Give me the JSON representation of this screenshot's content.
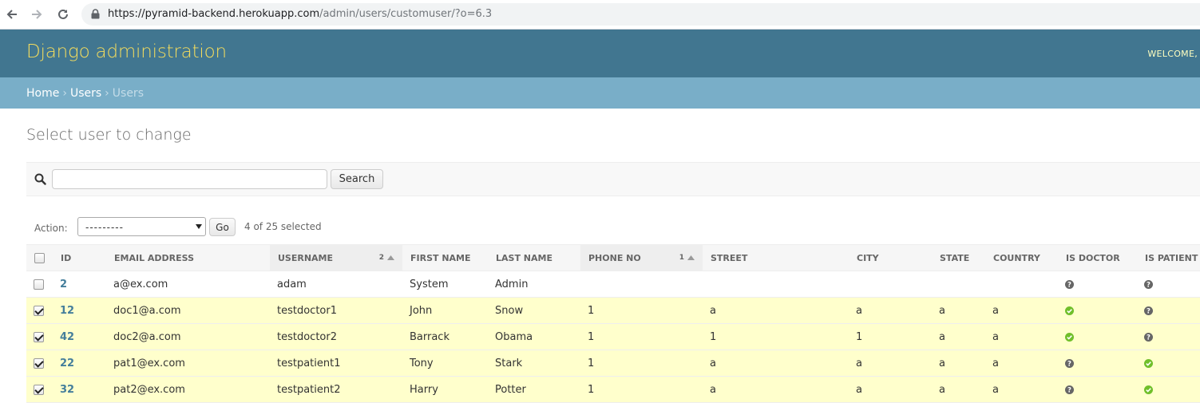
{
  "browser": {
    "url_host": "https://pyramid-backend.herokuapp.com",
    "url_path": "/admin/users/customuser/?o=6.3"
  },
  "header": {
    "branding": "Django administration",
    "user_tools": "WELCOME,"
  },
  "breadcrumbs": {
    "home": "Home",
    "app": "Users",
    "current": "Users",
    "separator": "›"
  },
  "page": {
    "title": "Select user to change"
  },
  "search": {
    "value": "",
    "placeholder": "",
    "button_label": "Search"
  },
  "actions": {
    "label": "Action:",
    "selected_value": "---------",
    "go_label": "Go",
    "counter": "4 of 25 selected"
  },
  "table": {
    "columns": [
      {
        "label": "ID"
      },
      {
        "label": "EMAIL ADDRESS"
      },
      {
        "label": "USERNAME",
        "sort_priority": "2",
        "sort_dir": "asc"
      },
      {
        "label": "FIRST NAME"
      },
      {
        "label": "LAST NAME"
      },
      {
        "label": "PHONE NO",
        "sort_priority": "1",
        "sort_dir": "asc"
      },
      {
        "label": "STREET"
      },
      {
        "label": "CITY"
      },
      {
        "label": "STATE"
      },
      {
        "label": "COUNTRY"
      },
      {
        "label": "IS DOCTOR"
      },
      {
        "label": "IS PATIENT"
      }
    ],
    "rows": [
      {
        "checked": false,
        "id": "2",
        "email": "a@ex.com",
        "username": "adam",
        "first_name": "System",
        "last_name": "Admin",
        "phone": "",
        "street": "",
        "city": "",
        "state": "",
        "country": "",
        "is_doctor": false,
        "is_patient": false
      },
      {
        "checked": true,
        "id": "12",
        "email": "doc1@a.com",
        "username": "testdoctor1",
        "first_name": "John",
        "last_name": "Snow",
        "phone": "1",
        "street": "a",
        "city": "a",
        "state": "a",
        "country": "a",
        "is_doctor": true,
        "is_patient": false
      },
      {
        "checked": true,
        "id": "42",
        "email": "doc2@a.com",
        "username": "testdoctor2",
        "first_name": "Barrack",
        "last_name": "Obama",
        "phone": "1",
        "street": "1",
        "city": "1",
        "state": "a",
        "country": "a",
        "is_doctor": true,
        "is_patient": false
      },
      {
        "checked": true,
        "id": "22",
        "email": "pat1@ex.com",
        "username": "testpatient1",
        "first_name": "Tony",
        "last_name": "Stark",
        "phone": "1",
        "street": "a",
        "city": "a",
        "state": "a",
        "country": "a",
        "is_doctor": false,
        "is_patient": true
      },
      {
        "checked": true,
        "id": "32",
        "email": "pat2@ex.com",
        "username": "testpatient2",
        "first_name": "Harry",
        "last_name": "Potter",
        "phone": "1",
        "street": "a",
        "city": "a",
        "state": "a",
        "country": "a",
        "is_doctor": false,
        "is_patient": true
      }
    ]
  },
  "icons": {
    "boolean_true": "yes-icon",
    "boolean_false": "unknown-icon"
  },
  "colors": {
    "header_bg": "#417690",
    "branding": "#f5dd5d",
    "breadcrumbs_bg": "#79aec8",
    "selected_row": "#ffffcc",
    "link": "#447e9b",
    "yes": "#70bf2b",
    "unknown": "#666666"
  }
}
